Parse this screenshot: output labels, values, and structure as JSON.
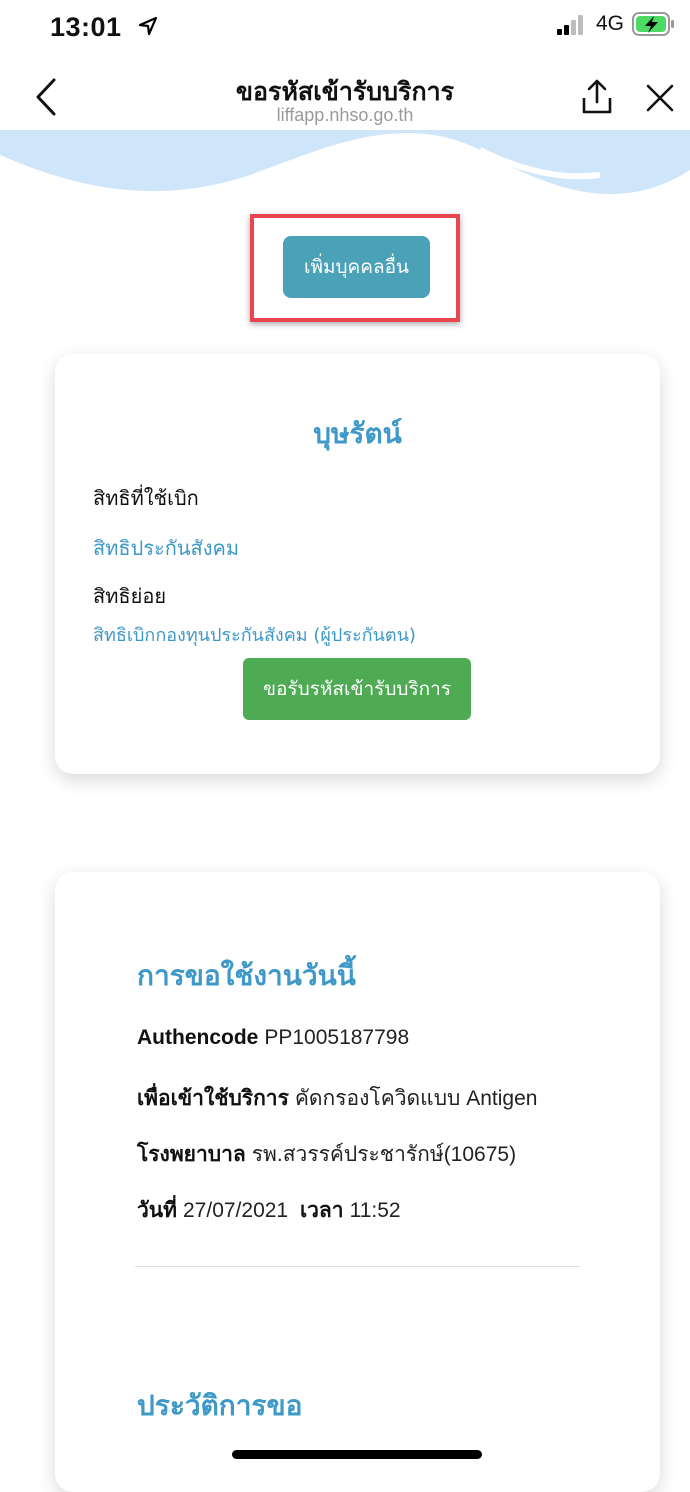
{
  "status_bar": {
    "time": "13:01",
    "network": "4G"
  },
  "nav": {
    "title": "ขอรหัสเข้ารับบริการ",
    "subtitle": "liffapp.nhso.go.th"
  },
  "add_person_button": "เพิ่มบุคคลอื่น",
  "person_card": {
    "name": "บุษรัตน์",
    "right_label": "สิทธิที่ใช้เบิก",
    "right_value": "สิทธิประกันสังคม",
    "subright_label": "สิทธิย่อย",
    "subright_value": "สิทธิเบิกกองทุนประกันสังคม (ผู้ประกันตน)",
    "request_button": "ขอรับรหัสเข้ารับบริการ"
  },
  "today_card": {
    "title": "การขอใช้งานวันนี้",
    "authencode_label": "Authencode",
    "authencode_value": "PP1005187798",
    "purpose_label": "เพื่อเข้าใช้บริการ",
    "purpose_value": "คัดกรองโควิดแบบ Antigen",
    "hospital_label": "โรงพยาบาล",
    "hospital_value": "รพ.สวรรค์ประชารักษ์(10675)",
    "date_label": "วันที่",
    "date_value": "27/07/2021",
    "time_label": "เวลา",
    "time_value": "11:52",
    "history_title": "ประวัติการขอ"
  },
  "colors": {
    "accent_blue": "#3e98c8",
    "add_button": "#4ba1b8",
    "request_button": "#4faa54",
    "highlight_border": "#ea4651",
    "wave": "#cfe6fa",
    "battery": "#4cd964"
  },
  "icons": [
    "location-arrow-icon",
    "signal-icon",
    "battery-charging-icon",
    "back-chevron-icon",
    "share-icon",
    "close-icon"
  ]
}
